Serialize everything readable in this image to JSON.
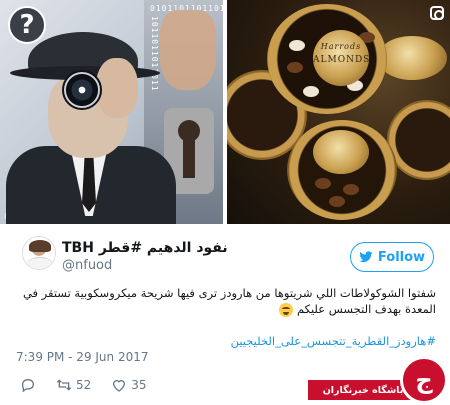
{
  "images": {
    "left": {
      "icon": "question-mark-icon",
      "question_glyph": "?"
    },
    "right": {
      "icon": "instagram-icon",
      "lid_brand": "Harrods",
      "lid_label": "ALMONDS"
    }
  },
  "tweet": {
    "display_name": "TBH نفود الدهيم #قطر",
    "handle": "@nfuod",
    "follow_label": "Follow",
    "text": "شفتوا الشوكولاطات اللي شريتوها من هارودز ترى فيها شريحة ميكروسكوبية تستقر في المعدة بهدف التجسس عليكم",
    "emoji": "crying-laughing-emoji",
    "hashtag": "#هارودز_القطرية_تتجسس_على_الخليجيين",
    "timestamp": "7:39 PM - 29 Jun 2017",
    "retweets": "52",
    "likes": "35"
  },
  "watermark": {
    "label": "باشگاه خبرنگاران",
    "logo_glyph": "ج"
  },
  "colors": {
    "twitter_blue": "#1da1f2",
    "hashtag_blue": "#1b95e0",
    "meta_gray": "#657786",
    "watermark_red": "#c8102e"
  }
}
